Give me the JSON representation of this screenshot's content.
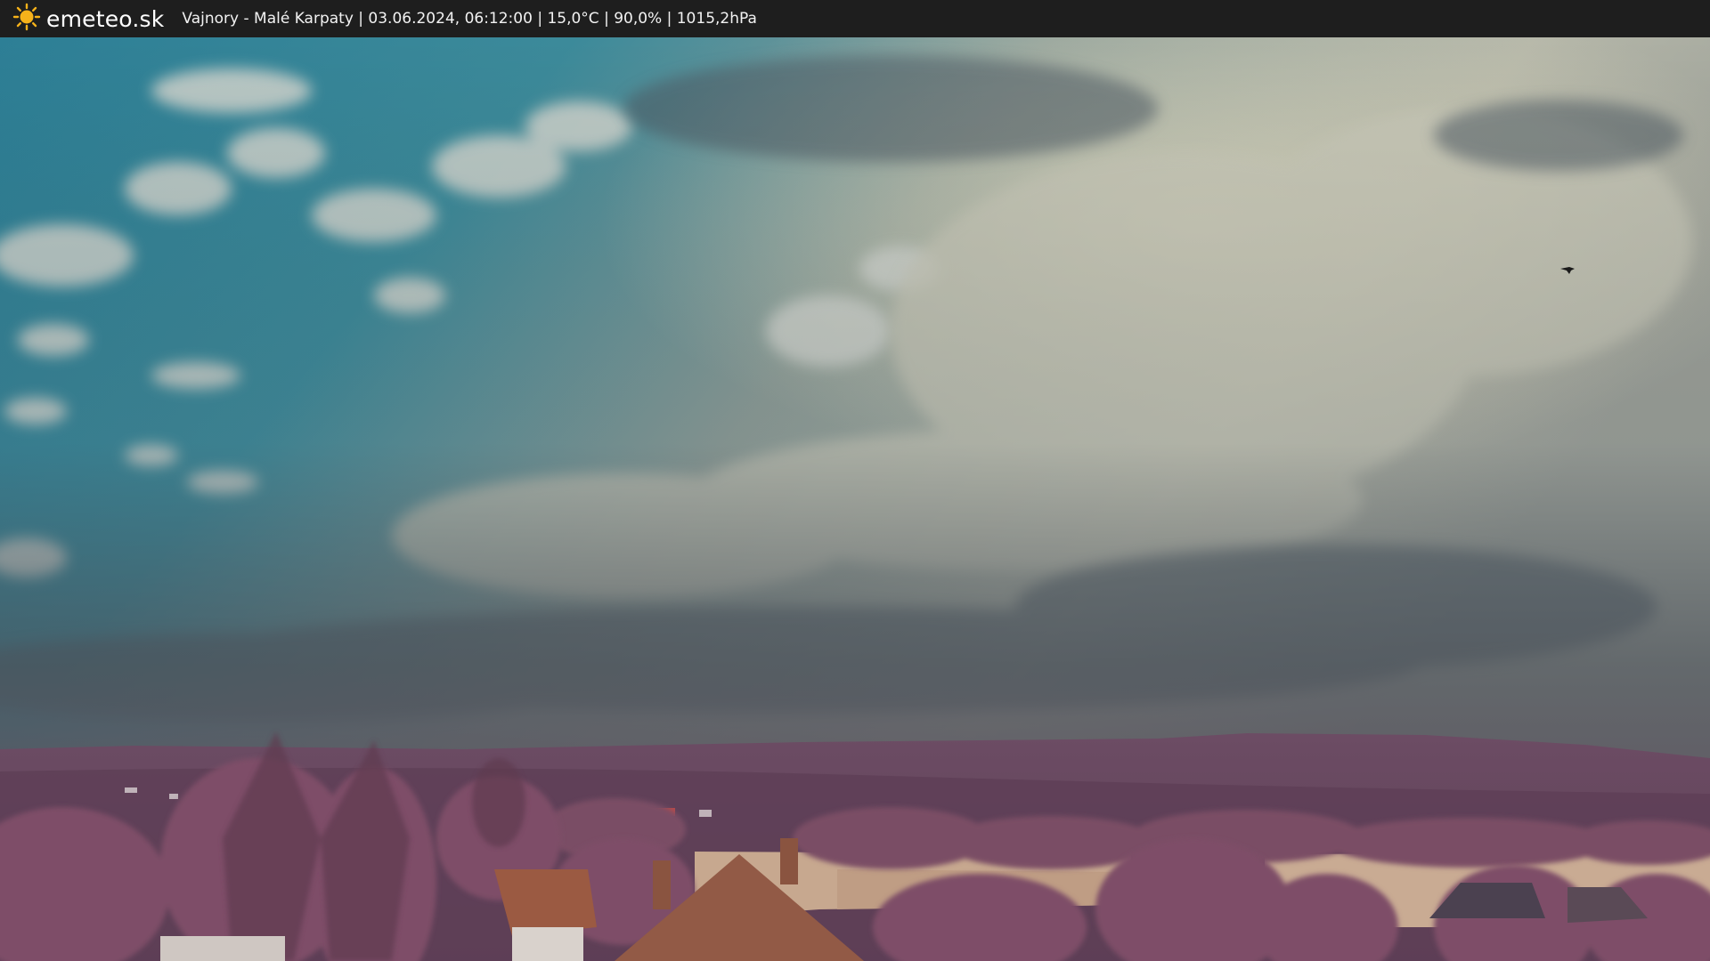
{
  "header": {
    "brand": "emeteo.sk",
    "caption": "Vajnory - Malé Karpaty | 03.06.2024, 06:12:00 | 15,0°C | 90,0% | 1015,2hPa",
    "logo_icon": "sun-icon"
  },
  "colors": {
    "bar_background": "#1e1e1e",
    "sun_yellow": "#f6b21a",
    "sky_blue": "#2f7e95",
    "cloud_grey": "#a4a69c",
    "foliage_pink": "#7a4b62"
  }
}
